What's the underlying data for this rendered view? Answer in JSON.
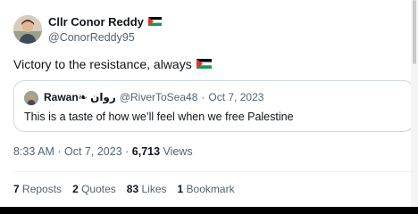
{
  "tweet": {
    "author": {
      "name": "Cllr Conor Reddy",
      "handle": "@ConorReddy95",
      "flag_icon": "palestine-flag-icon",
      "avatar_icon": "avatar-photo"
    },
    "text": "Victory to the resistance, always",
    "text_flag_icon": "palestine-flag-icon",
    "quote": {
      "name": "Rawan❧ روان",
      "handle": "@RiverToSea48",
      "separator": "·",
      "date": "Oct 7, 2023",
      "text": "This is a taste of how we’ll feel when we free Palestine"
    },
    "time": "8:33 AM",
    "date": "Oct 7, 2023",
    "separator": "·",
    "views_count": "6,713",
    "views_label": "Views",
    "stats": [
      {
        "count": "7",
        "label": "Reposts"
      },
      {
        "count": "2",
        "label": "Quotes"
      },
      {
        "count": "83",
        "label": "Likes"
      },
      {
        "count": "1",
        "label": "Bookmark"
      }
    ]
  },
  "colors": {
    "text_primary": "#0f1419",
    "text_secondary": "#536471",
    "border": "#cfd9de",
    "flag_black": "#000000",
    "flag_white": "#ffffff",
    "flag_green": "#149954",
    "flag_red": "#e4312b"
  }
}
